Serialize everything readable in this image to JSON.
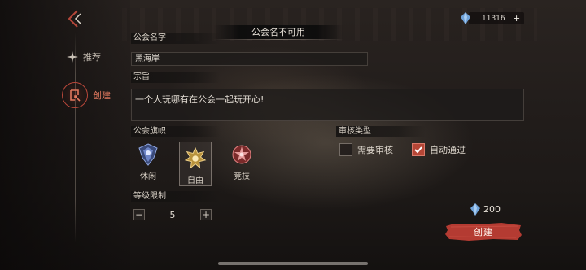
{
  "nav": {
    "items": [
      {
        "label": "推荐",
        "icon": "sparkle-icon"
      },
      {
        "label": "创建",
        "icon": "create-icon",
        "active": true
      }
    ]
  },
  "currency": {
    "amount": "11316",
    "icon": "crystal-icon"
  },
  "dialog": {
    "title": "公会名不可用",
    "name_label": "公会名字",
    "name_value": "黑海岸",
    "motto_label": "宗旨",
    "motto_value": "一个人玩哪有在公会一起玩开心!",
    "flag_label": "公会旗帜",
    "flags": [
      {
        "label": "休闲",
        "icon": "leisure-flag-icon",
        "selected": false
      },
      {
        "label": "自由",
        "icon": "free-flag-icon",
        "selected": true
      },
      {
        "label": "竞技",
        "icon": "compete-flag-icon",
        "selected": false
      }
    ],
    "review_label": "审核类型",
    "review_options": [
      {
        "label": "需要审核",
        "checked": false
      },
      {
        "label": "自动通过",
        "checked": true
      }
    ],
    "level_label": "等级限制",
    "level_value": "5",
    "cost": "200",
    "create_label": "创建"
  },
  "colors": {
    "accent": "#b54636",
    "active_nav": "#e2795f"
  }
}
